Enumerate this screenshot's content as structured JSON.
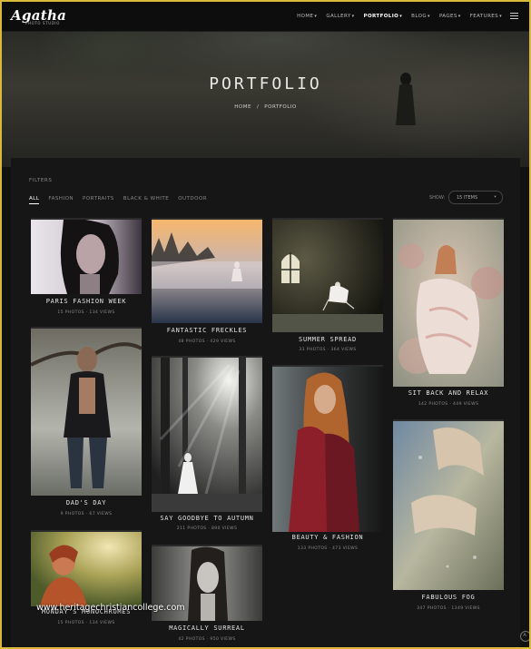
{
  "brand": {
    "logo": "Agatha",
    "tagline": "PHOTO STUDIO"
  },
  "nav": {
    "items": [
      {
        "label": "HOME"
      },
      {
        "label": "GALLERY"
      },
      {
        "label": "PORTFOLIO"
      },
      {
        "label": "BLOG"
      },
      {
        "label": "PAGES"
      },
      {
        "label": "FEATURES"
      }
    ],
    "active": "PORTFOLIO"
  },
  "hero": {
    "title": "PORTFOLIO",
    "breadcrumb": {
      "home": "HOME",
      "sep": "/",
      "current": "PORTFOLIO"
    }
  },
  "filters": {
    "label": "FILTERS",
    "tabs": [
      "ALL",
      "FASHION",
      "PORTRAITS",
      "BLACK & WHITE",
      "OUTDOOR"
    ],
    "active": "ALL",
    "show_label": "SHOW:",
    "show_value": "15 ITEMS"
  },
  "portfolio": {
    "items": [
      {
        "title": "PARIS FASHION WEEK",
        "meta": "15 PHOTOS · 134 VIEWS"
      },
      {
        "title": "DAD'S DAY",
        "meta": "9 PHOTOS · 67 VIEWS"
      },
      {
        "title": "MONDAY'S MONOCHROMES",
        "meta": "15 PHOTOS · 134 VIEWS"
      },
      {
        "title": "FANTASTIC FRECKLES",
        "meta": "48 PHOTOS · 429 VIEWS"
      },
      {
        "title": "SAY GOODBYE TO AUTUMN",
        "meta": "211 PHOTOS · 890 VIEWS"
      },
      {
        "title": "MAGICALLY SURREAL",
        "meta": "42 PHOTOS · 950 VIEWS"
      },
      {
        "title": "SUMMER SPREAD",
        "meta": "33 PHOTOS · 364 VIEWS"
      },
      {
        "title": "BEAUTY & FASHION",
        "meta": "133 PHOTOS · 473 VIEWS"
      },
      {
        "title": "SIT BACK AND RELAX",
        "meta": "142 PHOTOS · 449 VIEWS"
      },
      {
        "title": "FABULOUS FOG",
        "meta": "347 PHOTOS · 1349 VIEWS"
      }
    ]
  },
  "watermark": "www.heritagechristiancollege.com"
}
